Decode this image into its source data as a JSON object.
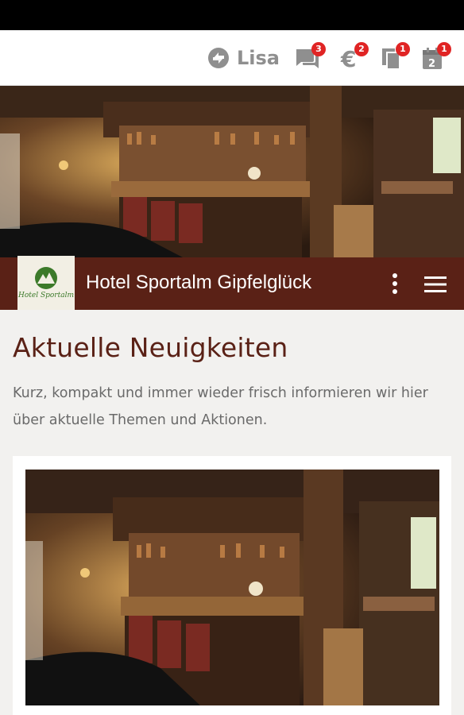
{
  "user": {
    "name": "Lisa"
  },
  "toolbar": {
    "messages_count": "3",
    "payments_count": "2",
    "documents_count": "1",
    "calendar_count": "1",
    "calendar_day": "2"
  },
  "hotel": {
    "name": "Hotel Sportalm Gipfelglück",
    "logo_text": "Hotel Sportalm"
  },
  "content": {
    "title": "Aktuelle Neuigkeiten",
    "description": "Kurz, kompakt und immer wieder frisch informieren wir hier über aktuelle Themen und Aktionen."
  },
  "colors": {
    "brand": "#5a2116",
    "badge": "#e02424",
    "icon_gray": "#8f8f8f"
  },
  "icons": [
    "sync-icon",
    "chat-icon",
    "euro-icon",
    "documents-icon",
    "calendar-icon",
    "more-vert-icon",
    "menu-icon"
  ]
}
